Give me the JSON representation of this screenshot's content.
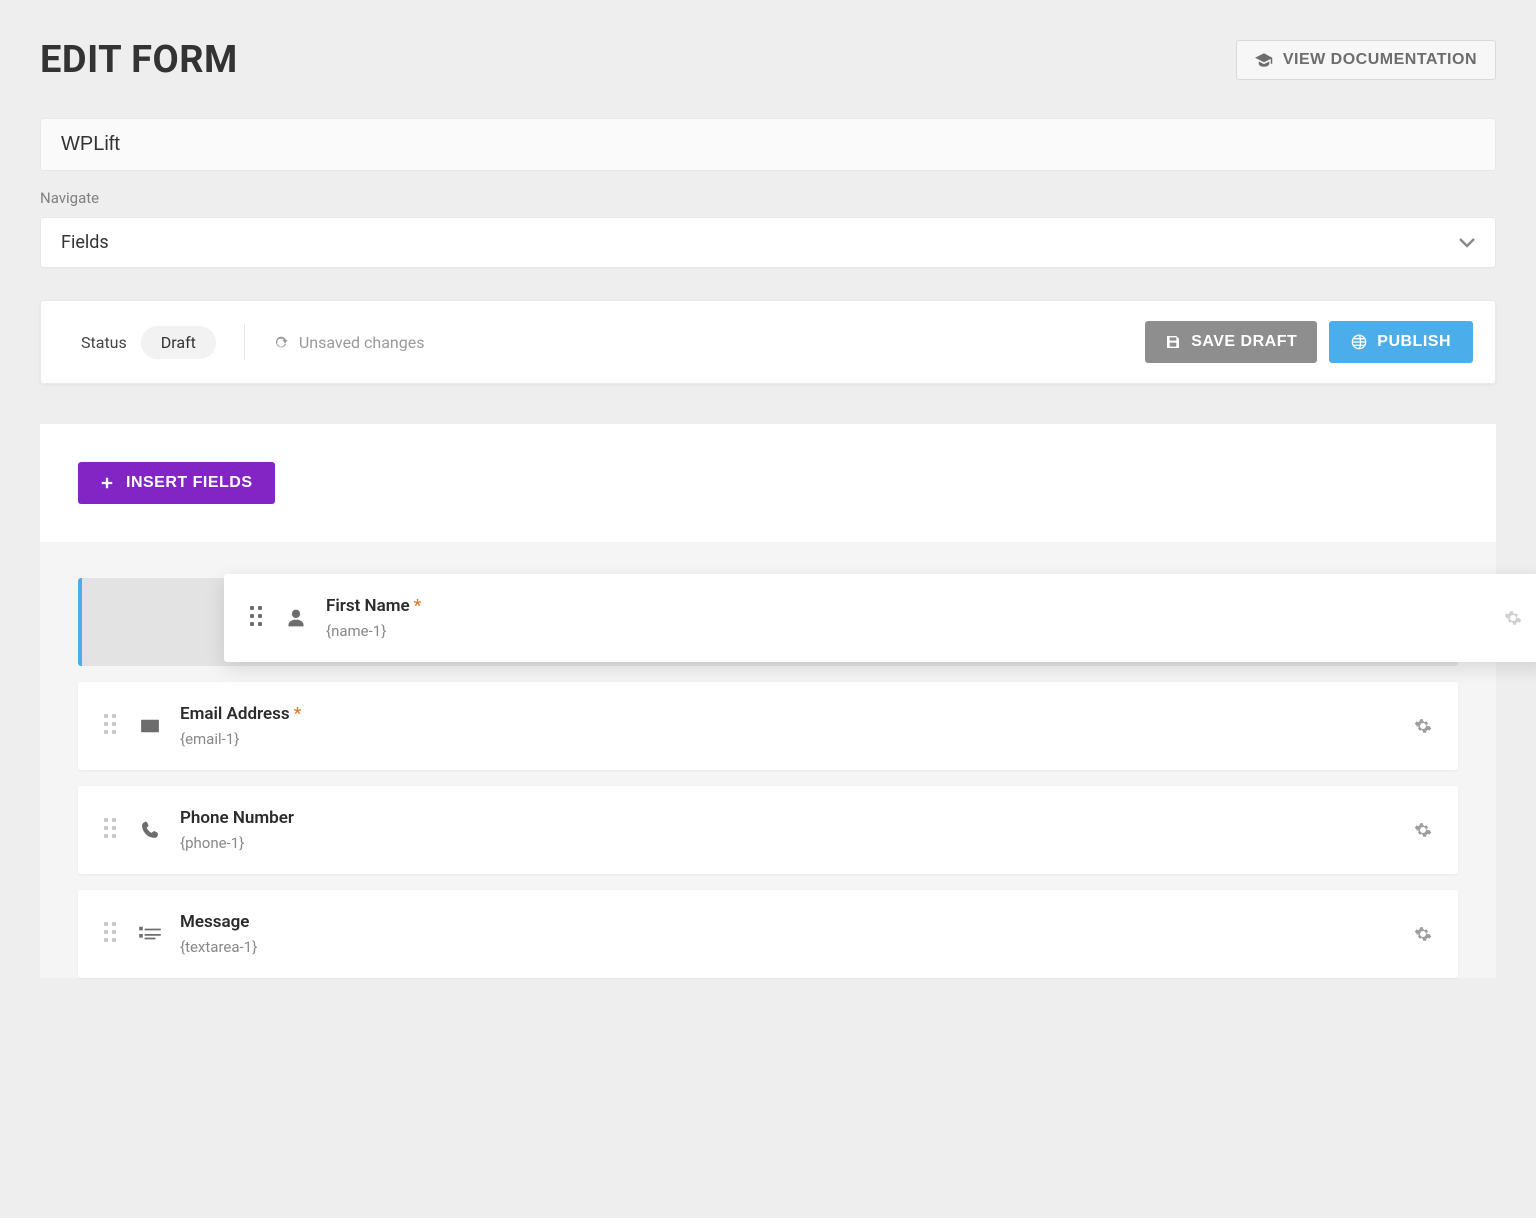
{
  "header": {
    "title": "EDIT FORM",
    "doc_button": "VIEW DOCUMENTATION"
  },
  "form_name": "WPLift",
  "navigate_label": "Navigate",
  "navigate_value": "Fields",
  "status": {
    "label": "Status",
    "value": "Draft",
    "unsaved": "Unsaved changes",
    "save_draft": "SAVE DRAFT",
    "publish": "PUBLISH"
  },
  "insert_fields_label": "INSERT FIELDS",
  "fields": [
    {
      "label": "First Name",
      "token": "{name-1}",
      "icon": "person-icon",
      "required": true
    },
    {
      "label": "Email Address",
      "token": "{email-1}",
      "icon": "envelope-icon",
      "required": true
    },
    {
      "label": "Phone Number",
      "token": "{phone-1}",
      "icon": "phone-icon",
      "required": false
    },
    {
      "label": "Message",
      "token": "{textarea-1}",
      "icon": "textarea-icon",
      "required": false
    }
  ]
}
